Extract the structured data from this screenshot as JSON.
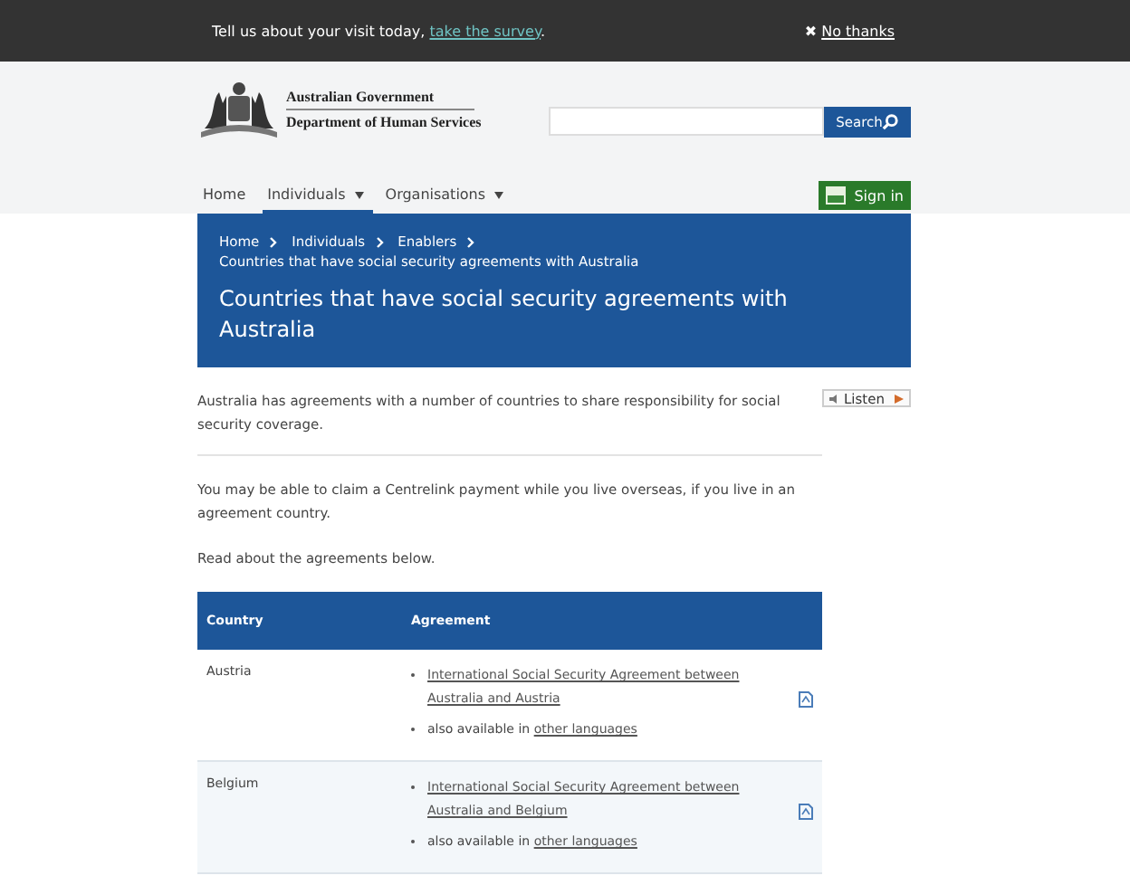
{
  "survey_bar": {
    "prefix": "Tell us about your visit today, ",
    "link": "take the survey",
    "suffix": ".",
    "dismiss_icon": "✖",
    "dismiss": "No thanks"
  },
  "header": {
    "agency_line_1": "Australian Government",
    "agency_line_2": "Department of Human Services",
    "search": {
      "button": "Search"
    }
  },
  "nav": {
    "items": [
      {
        "label": "Home",
        "has_menu": false,
        "selected": false
      },
      {
        "label": "Individuals",
        "has_menu": true,
        "selected": true
      },
      {
        "label": "Organisations",
        "has_menu": true,
        "selected": false
      }
    ],
    "sign_in": "Sign in"
  },
  "breadcrumb": [
    {
      "label": "Home"
    },
    {
      "label": "Individuals"
    },
    {
      "label": "Enablers"
    }
  ],
  "breadcrumb_current": "Countries that have social security agreements with Australia",
  "page_title": "Countries that have social security agreements with Australia",
  "listen_button": "Listen",
  "paragraphs": [
    "Australia has agreements with a number of countries to share responsibility for social security coverage.",
    "You may be able to claim a Centrelink payment while you live overseas, if you live in an agreement country.",
    "Read about the agreements below."
  ],
  "table": {
    "columns": [
      "Country",
      "Agreement"
    ],
    "rows": [
      {
        "country": "Austria",
        "agreement_link": "International Social Security Agreement between Australia and Austria",
        "also_text": "also available in ",
        "also_link": "other languages"
      },
      {
        "country": "Belgium",
        "agreement_link": "International Social Security Agreement between Australia and Belgium",
        "also_text": "also available in ",
        "also_link": "other languages"
      }
    ]
  }
}
